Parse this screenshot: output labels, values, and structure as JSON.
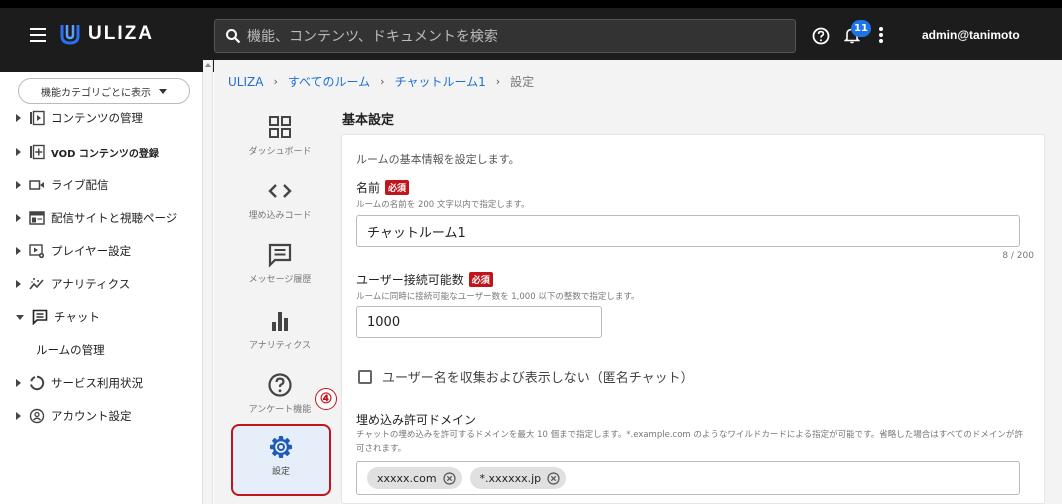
{
  "header": {
    "brand": "ULIZA",
    "search_placeholder": "機能、コンテンツ、ドキュメントを検索",
    "notification_count": "11",
    "user": "admin@tanimoto"
  },
  "sidebar": {
    "category_select": "機能カテゴリごとに表示",
    "items": [
      {
        "label": "コンテンツの管理",
        "icon": "content-play-icon"
      },
      {
        "label": "VOD コンテンツの登録",
        "icon": "add-box-icon"
      },
      {
        "label": "ライブ配信",
        "icon": "live-camera-icon"
      },
      {
        "label": "配信サイトと視聴ページ",
        "icon": "site-page-icon"
      },
      {
        "label": "プレイヤー設定",
        "icon": "player-settings-icon"
      },
      {
        "label": "アナリティクス",
        "icon": "analytics-icon"
      },
      {
        "label": "チャット",
        "icon": "chat-icon"
      },
      {
        "label": "サービス利用状況",
        "icon": "usage-circle-icon"
      },
      {
        "label": "アカウント設定",
        "icon": "account-icon"
      }
    ],
    "sub_item": "ルームの管理"
  },
  "breadcrumb": {
    "items": [
      "ULIZA",
      "すべてのルーム",
      "チャットルーム1"
    ],
    "current": "設定",
    "separator": "›"
  },
  "subnav": {
    "items": [
      {
        "label": "ダッシュボード",
        "icon": "dashboard-icon"
      },
      {
        "label": "埋め込みコード",
        "icon": "code-icon"
      },
      {
        "label": "メッセージ履歴",
        "icon": "message-icon"
      },
      {
        "label": "アナリティクス",
        "icon": "bar-chart-icon"
      },
      {
        "label": "アンケート機能",
        "icon": "help-circle-icon"
      },
      {
        "label": "設定",
        "icon": "gear-icon",
        "active": true
      }
    ]
  },
  "annotation_number": "④",
  "settings": {
    "title": "基本設定",
    "intro": "ルームの基本情報を設定します。",
    "required_label": "必須",
    "name": {
      "label": "名前",
      "hint": "ルームの名前を 200 文字以内で指定します。",
      "value": "チャットルーム1",
      "counter": "8 / 200"
    },
    "max_users": {
      "label": "ユーザー接続可能数",
      "hint": "ルームに同時に接続可能なユーザー数を 1,000 以下の整数で指定します。",
      "value": "1000"
    },
    "anonymous": {
      "label": "ユーザー名を収集および表示しない（匿名チャット）",
      "checked": false
    },
    "domains": {
      "label": "埋め込み許可ドメイン",
      "hint": "チャットの埋め込みを許可するドメインを最大 10 個まで指定します。*.example.com のようなワイルドカードによる指定が可能です。省略した場合はすべてのドメインが許可されます。",
      "chips": [
        "xxxxx.com",
        "*.xxxxxx.jp"
      ]
    }
  },
  "colors": {
    "topbar": "#1c1c1c",
    "accent_blue": "#1e6fd0",
    "required_red": "#c0151b",
    "active_bg": "#e6eef9"
  }
}
